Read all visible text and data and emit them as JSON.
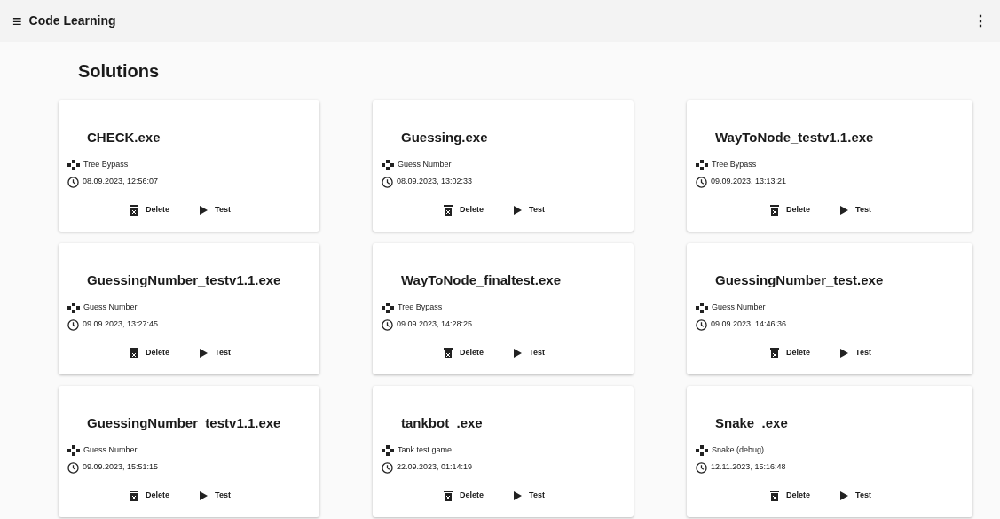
{
  "app_bar": {
    "menu_icon": "≡",
    "title": "Code Learning",
    "more_icon": "⋮"
  },
  "page_title": "Solutions",
  "solutions": [
    {
      "name": "CHECK.exe",
      "task": "Tree Bypass",
      "date": "08.09.2023, 12:56:07",
      "actions": [
        "Delete",
        "Test"
      ]
    },
    {
      "name": "Guessing.exe",
      "task": "Guess Number",
      "date": "08.09.2023, 13:02:33",
      "actions": [
        "Delete",
        "Test"
      ]
    },
    {
      "name": "WayToNode_testv1.1.exe",
      "task": "Tree Bypass",
      "date": "09.09.2023, 13:13:21",
      "actions": [
        "Delete",
        "Test"
      ]
    },
    {
      "name": "GuessingNumber_testv1.1.exe",
      "task": "Guess Number",
      "date": "09.09.2023, 13:27:45",
      "actions": [
        "Delete",
        "Test"
      ]
    },
    {
      "name": "WayToNode_finaltest.exe",
      "task": "Tree Bypass",
      "date": "09.09.2023, 14:28:25",
      "actions": [
        "Delete",
        "Test"
      ]
    },
    {
      "name": "GuessingNumber_test.exe",
      "task": "Guess Number",
      "date": "09.09.2023, 14:46:36",
      "actions": [
        "Delete",
        "Test"
      ]
    },
    {
      "name": "GuessingNumber_testv1.1.exe",
      "task": "Guess Number",
      "date": "09.09.2023, 15:51:15",
      "actions": [
        "Delete",
        "Test"
      ]
    },
    {
      "name": "tankbot_.exe",
      "task": "Tank test game",
      "date": "22.09.2023, 01:14:19",
      "actions": [
        "Delete",
        "Test"
      ]
    },
    {
      "name": "Snake_.exe",
      "task": "Snake (debug)",
      "date": "12.11.2023, 15:16:48",
      "actions": [
        "Delete",
        "Test"
      ]
    }
  ]
}
